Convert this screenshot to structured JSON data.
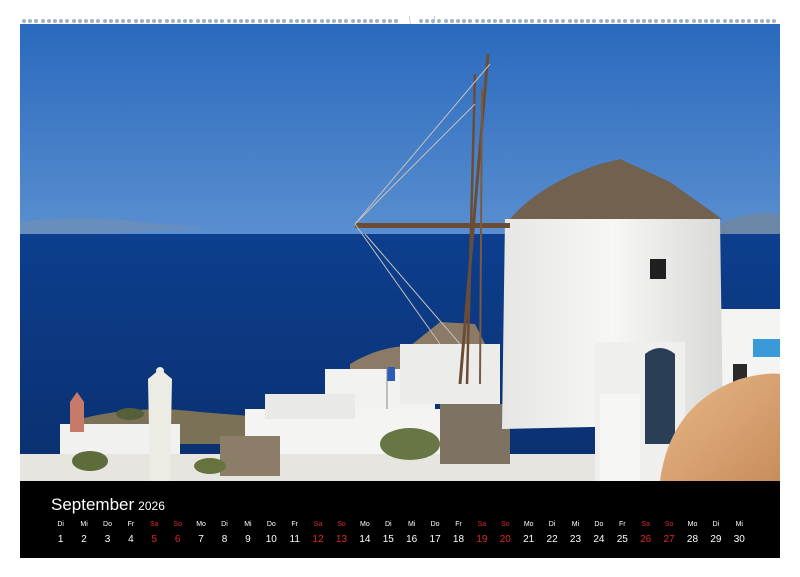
{
  "calendar": {
    "month": "September",
    "year": "2026",
    "weekend_color": "#e0262b",
    "days": [
      {
        "name": "Di",
        "date": "1",
        "weekend": false
      },
      {
        "name": "Mi",
        "date": "2",
        "weekend": false
      },
      {
        "name": "Do",
        "date": "3",
        "weekend": false
      },
      {
        "name": "Fr",
        "date": "4",
        "weekend": false
      },
      {
        "name": "Sa",
        "date": "5",
        "weekend": true
      },
      {
        "name": "So",
        "date": "6",
        "weekend": true
      },
      {
        "name": "Mo",
        "date": "7",
        "weekend": false
      },
      {
        "name": "Di",
        "date": "8",
        "weekend": false
      },
      {
        "name": "Mi",
        "date": "9",
        "weekend": false
      },
      {
        "name": "Do",
        "date": "10",
        "weekend": false
      },
      {
        "name": "Fr",
        "date": "11",
        "weekend": false
      },
      {
        "name": "Sa",
        "date": "12",
        "weekend": true
      },
      {
        "name": "So",
        "date": "13",
        "weekend": true
      },
      {
        "name": "Mo",
        "date": "14",
        "weekend": false
      },
      {
        "name": "Di",
        "date": "15",
        "weekend": false
      },
      {
        "name": "Mi",
        "date": "16",
        "weekend": false
      },
      {
        "name": "Do",
        "date": "17",
        "weekend": false
      },
      {
        "name": "Fr",
        "date": "18",
        "weekend": false
      },
      {
        "name": "Sa",
        "date": "19",
        "weekend": true
      },
      {
        "name": "So",
        "date": "20",
        "weekend": true
      },
      {
        "name": "Mo",
        "date": "21",
        "weekend": false
      },
      {
        "name": "Di",
        "date": "22",
        "weekend": false
      },
      {
        "name": "Mi",
        "date": "23",
        "weekend": false
      },
      {
        "name": "Do",
        "date": "24",
        "weekend": false
      },
      {
        "name": "Fr",
        "date": "25",
        "weekend": false
      },
      {
        "name": "Sa",
        "date": "26",
        "weekend": true
      },
      {
        "name": "So",
        "date": "27",
        "weekend": true
      },
      {
        "name": "Mo",
        "date": "28",
        "weekend": false
      },
      {
        "name": "Di",
        "date": "29",
        "weekend": false
      },
      {
        "name": "Mi",
        "date": "30",
        "weekend": false
      }
    ]
  },
  "photo": {
    "sky_color": "#2f72c4",
    "sea_color": "#0c3a86",
    "windmill_color": "#f3f3f1",
    "roof_color": "#6e5e4b"
  }
}
